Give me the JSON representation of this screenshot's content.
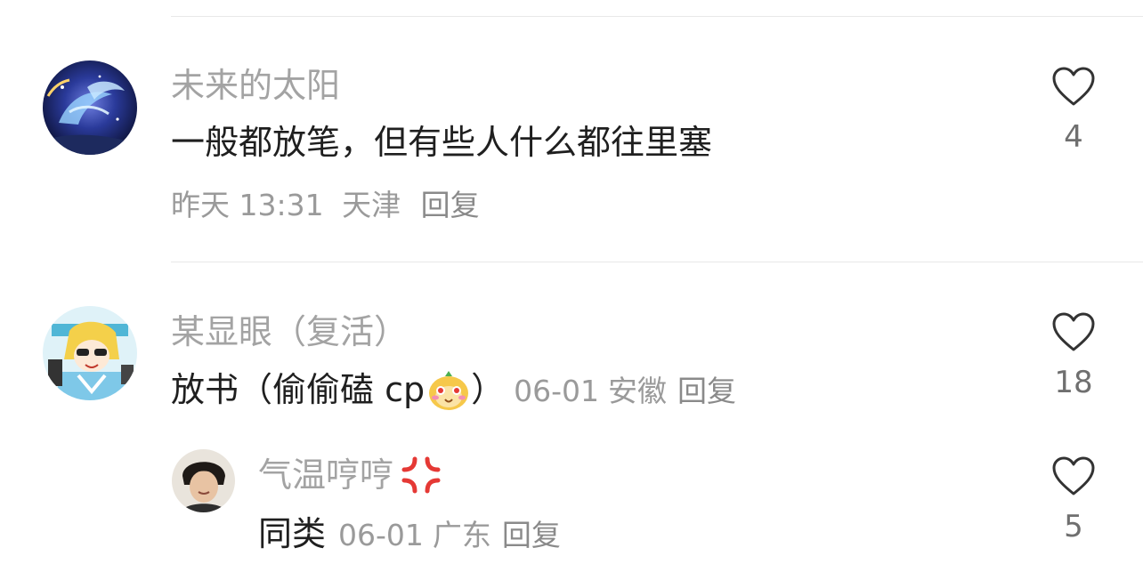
{
  "comments": [
    {
      "username": "未来的太阳",
      "text": "一般都放笔，但有些人什么都往里塞",
      "time": "昨天 13:31",
      "location": "天津",
      "reply_label": "回复",
      "likes": "4",
      "avatar_icon": "galaxy-avatar"
    },
    {
      "username": "某显眼（复活）",
      "text": "放书（偷偷磕 cp",
      "text_close": "）",
      "emoji_icon": "cute-blushing-emoji",
      "time": "06-01",
      "location": "安徽",
      "reply_label": "回复",
      "likes": "18",
      "avatar_icon": "anime-avatar",
      "replies": [
        {
          "username": "气温哼哼",
          "username_emoji": "anger-symbol-emoji",
          "text": "同类",
          "time": "06-01",
          "location": "广东",
          "reply_label": "回复",
          "likes": "5",
          "avatar_icon": "person-avatar"
        }
      ]
    }
  ],
  "colors": {
    "username": "#a3a3a3",
    "text": "#1f1f1f",
    "meta": "#9a9a9a",
    "heart": "#333333"
  }
}
